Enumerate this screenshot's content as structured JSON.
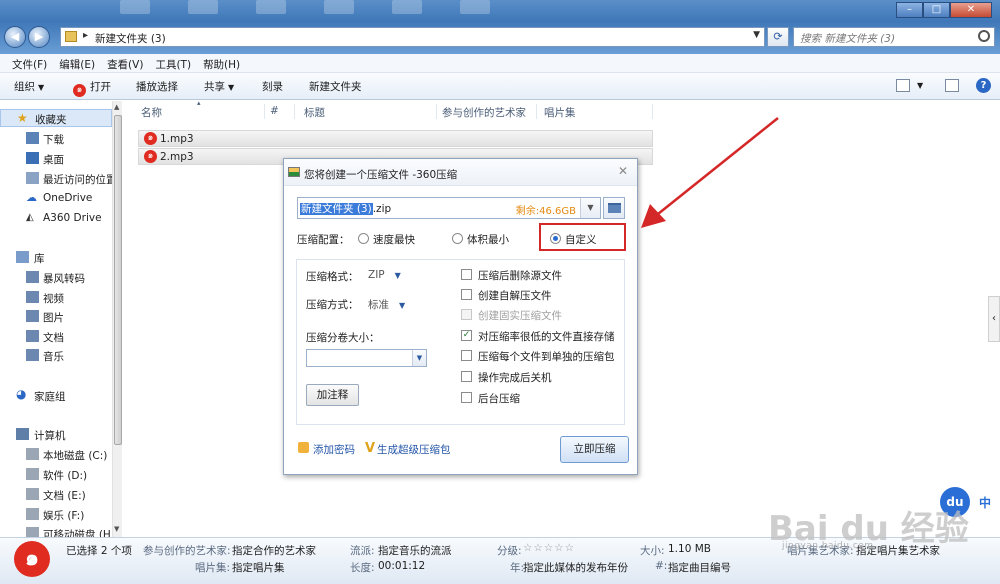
{
  "window": {
    "address_path": "新建文件夹 (3)",
    "search_placeholder": "搜索 新建文件夹 (3)",
    "controls": [
      "–",
      "□",
      "✕"
    ]
  },
  "menu": [
    "文件(F)",
    "编辑(E)",
    "查看(V)",
    "工具(T)",
    "帮助(H)"
  ],
  "toolbar": {
    "organize": "组织",
    "open": "打开",
    "play_selection": "播放选择",
    "share": "共享",
    "burn": "刻录",
    "new_folder": "新建文件夹"
  },
  "sidebar": {
    "favorites": "收藏夹",
    "downloads": "下载",
    "desktop": "桌面",
    "recent": "最近访问的位置",
    "onedrive": "OneDrive",
    "a360": "A360 Drive",
    "libraries": "库",
    "storm": "暴风转码",
    "videos": "视频",
    "pictures": "图片",
    "documents": "文档",
    "music": "音乐",
    "homegroup": "家庭组",
    "computer": "计算机",
    "disk_c": "本地磁盘 (C:)",
    "disk_d": "软件 (D:)",
    "disk_e": "文档 (E:)",
    "disk_f": "娱乐 (F:)",
    "disk_h": "可移动磁盘 (H:"
  },
  "columns": {
    "name": "名称",
    "number": "#",
    "title": "标题",
    "artist": "参与创作的艺术家",
    "album": "唱片集"
  },
  "files": [
    "1.mp3",
    "2.mp3"
  ],
  "dialog": {
    "title": "您将创建一个压缩文件 -360压缩",
    "filename_selected": "新建文件夹 (3)",
    "filename_ext": ".zip",
    "remaining": "剩余:46.6GB",
    "config_label": "压缩配置：",
    "option_fast": "速度最快",
    "option_small": "体积最小",
    "option_custom": "自定义",
    "format_label": "压缩格式：",
    "format_value": "ZIP",
    "method_label": "压缩方式：",
    "method_value": "标准",
    "split_label": "压缩分卷大小：",
    "add_comment": "加注释",
    "opt_delete_source": "压缩后删除源文件",
    "opt_sfx": "创建自解压文件",
    "opt_solid": "创建固实压缩文件",
    "opt_store_low": "对压缩率很低的文件直接存储",
    "opt_each_file": "压缩每个文件到单独的压缩包",
    "opt_shutdown": "操作完成后关机",
    "opt_background": "后台压缩",
    "add_password": "添加密码",
    "super_package": "生成超级压缩包",
    "compress_now": "立即压缩"
  },
  "status": {
    "selected": "已选择 2 个项",
    "artist_k": "参与创作的艺术家:",
    "artist_v": "指定合作的艺术家",
    "genre_k": "流派:",
    "genre_v": "指定音乐的流派",
    "rating_k": "分级:",
    "rating_stars": "☆☆☆☆☆",
    "size_k": "大小:",
    "size_v": "1.10 MB",
    "album_artist_k": "唱片集艺术家:",
    "album_artist_v": "指定唱片集艺术家",
    "album_k": "唱片集:",
    "album_v": "指定唱片集",
    "length_k": "长度:",
    "length_v": "00:01:12",
    "year_k": "年:",
    "year_v": "指定此媒体的发布年份",
    "track_k": "#:",
    "track_v": "指定曲目编号"
  },
  "watermark": {
    "text": "Bai du 经验",
    "url": "jingyan.baidu.com",
    "badge": "du",
    "lang": "中"
  },
  "colors": {
    "accent": "#3b7bd9",
    "annotation_red": "#d42727",
    "icon_360": "#e02b20"
  }
}
